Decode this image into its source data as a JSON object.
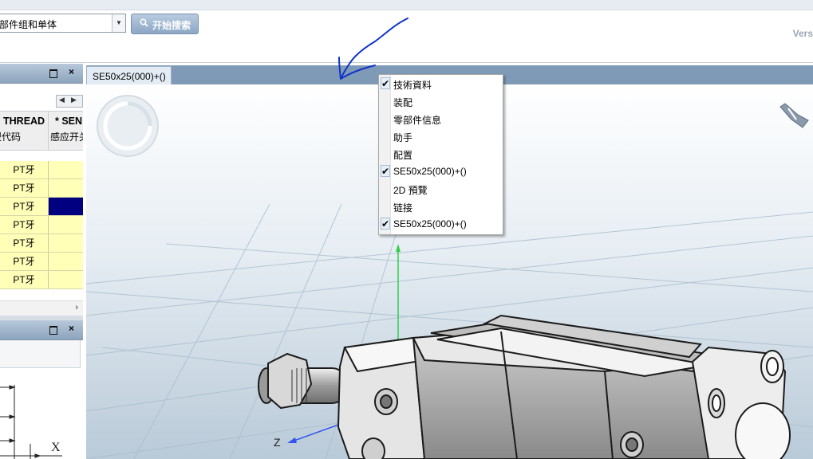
{
  "search": {
    "combo_value": "部件组和单体",
    "combo_arrow": "▼",
    "button_label": "开始搜索",
    "version_text": "Vers"
  },
  "left_panel": {
    "pane1": {
      "close": "×",
      "nav_left": "◀",
      "nav_right": "▶",
      "columns": [
        {
          "header": "THREAD",
          "sub": "型代码"
        },
        {
          "header": "* SEN",
          "sub": "感应开关"
        }
      ],
      "rows": [
        {
          "col1": "PT牙",
          "selected": false
        },
        {
          "col1": "PT牙",
          "selected": false
        },
        {
          "col1": "PT牙",
          "selected": true
        },
        {
          "col1": "PT牙",
          "selected": false
        },
        {
          "col1": "PT牙",
          "selected": false
        },
        {
          "col1": "PT牙",
          "selected": false
        },
        {
          "col1": "PT牙",
          "selected": false
        }
      ],
      "scroll_right": "›"
    },
    "pane2": {
      "close": "×",
      "axis_label": "X"
    }
  },
  "viewer": {
    "tab_label": "SE50x25(000)+()",
    "axis_z_label": "Z"
  },
  "context_menu": {
    "items": [
      {
        "label": "技術資料",
        "checked": true
      },
      {
        "label": "装配",
        "checked": false
      },
      {
        "label": "零部件信息",
        "checked": false
      },
      {
        "label": "助手",
        "checked": false
      },
      {
        "label": "配置",
        "checked": false
      },
      {
        "label": "SE50x25(000)+()",
        "checked": true
      },
      {
        "label": "2D 預覽",
        "checked": false
      },
      {
        "label": "链接",
        "checked": false
      },
      {
        "label": "SE50x25(000)+()",
        "checked": true
      }
    ],
    "check_glyph": "✔"
  },
  "colors": {
    "accent": "#7f9ab6",
    "selection": "#000080",
    "row_fill": "#ffffb8",
    "annotation_ink": "#1034c8"
  }
}
